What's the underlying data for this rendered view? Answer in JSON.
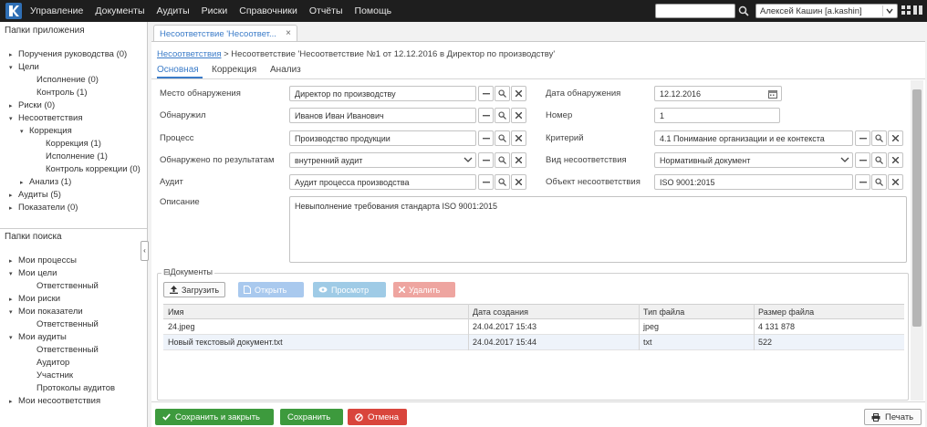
{
  "topbar": {
    "menu": [
      "Управление",
      "Документы",
      "Аудиты",
      "Риски",
      "Справочники",
      "Отчёты",
      "Помощь"
    ],
    "search_value": "",
    "user": "Алексей Кашин [a.kashin]"
  },
  "left_panel": {
    "app_folders_title": "Папки приложения",
    "app_tree": [
      {
        "label": "Поручения руководства (0)",
        "arrow": "▸"
      },
      {
        "label": "Цели",
        "arrow": "▾"
      },
      {
        "label": "Исполнение (0)",
        "arrow": ""
      },
      {
        "label": "Контроль (1)",
        "arrow": ""
      },
      {
        "label": "Риски (0)",
        "arrow": "▸"
      },
      {
        "label": "Несоответствия",
        "arrow": "▾"
      },
      {
        "label": "Коррекция",
        "arrow": "▾"
      },
      {
        "label": "Коррекция (1)",
        "arrow": ""
      },
      {
        "label": "Исполнение (1)",
        "arrow": ""
      },
      {
        "label": "Контроль коррекции (0)",
        "arrow": ""
      },
      {
        "label": "Анализ (1)",
        "arrow": "▸"
      },
      {
        "label": "Аудиты (5)",
        "arrow": "▸"
      },
      {
        "label": "Показатели (0)",
        "arrow": "▸"
      }
    ],
    "search_folders_title": "Папки поиска",
    "search_tree": [
      {
        "label": "Мои процессы",
        "arrow": "▸"
      },
      {
        "label": "Мои цели",
        "arrow": "▾"
      },
      {
        "label": "Ответственный",
        "arrow": ""
      },
      {
        "label": "Мои риски",
        "arrow": "▸"
      },
      {
        "label": "Мои показатели",
        "arrow": "▾"
      },
      {
        "label": "Ответственный",
        "arrow": ""
      },
      {
        "label": "Мои аудиты",
        "arrow": "▾"
      },
      {
        "label": "Ответственный",
        "arrow": ""
      },
      {
        "label": "Аудитор",
        "arrow": ""
      },
      {
        "label": "Участник",
        "arrow": ""
      },
      {
        "label": "Протоколы аудитов",
        "arrow": ""
      },
      {
        "label": "Мои несоответствия",
        "arrow": "▸"
      }
    ],
    "collapse_glyph": "‹"
  },
  "doc_tab": {
    "label": "Несоответствие 'Несоответ...",
    "close": "×"
  },
  "breadcrumb": {
    "link": "Несоответствия",
    "rest": " > Несоответствие 'Несоответствие №1 от 12.12.2016 в Директор по производству'"
  },
  "subtabs": [
    "Основная",
    "Коррекция",
    "Анализ"
  ],
  "form": {
    "place_label": "Место обнаружения",
    "place_value": "Директор по производству",
    "found_by_label": "Обнаружил",
    "found_by_value": "Иванов Иван Иванович",
    "process_label": "Процесс",
    "process_value": "Производство продукции",
    "found_result_label": "Обнаружено по результатам",
    "found_result_value": "внутренний аудит",
    "audit_label": "Аудит",
    "audit_value": "Аудит процесса производства",
    "date_label": "Дата обнаружения",
    "date_value": "12.12.2016",
    "number_label": "Номер",
    "number_value": "1",
    "criterion_label": "Критерий",
    "criterion_value": "4.1  Понимание организации и ее контекста",
    "type_label": "Вид несоответствия",
    "type_value": "Нормативный документ",
    "object_label": "Объект несоответствия",
    "object_value": "ISO 9001:2015",
    "description_label": "Описание",
    "description_value": "Невыполнение требования стандарта ISO 9001:2015"
  },
  "documents": {
    "legend": "⊟Документы",
    "buttons": {
      "upload": "Загрузить",
      "open": "Открыть",
      "view": "Просмотр",
      "delete": "Удалить"
    },
    "columns": [
      "Имя",
      "Дата создания",
      "Тип файла",
      "Размер файла"
    ],
    "rows": [
      [
        "24.jpeg",
        "24.04.2017 15:43",
        "jpeg",
        "4 131 878"
      ],
      [
        "Новый текстовый документ.txt",
        "24.04.2017 15:44",
        "txt",
        "522"
      ]
    ]
  },
  "footer": {
    "save_close": "Сохранить и закрыть",
    "save": "Сохранить",
    "cancel": "Отмена",
    "print": "Печать"
  },
  "colors": {
    "accent": "#3a7bc8",
    "save_green": "#3d9a3d",
    "cancel_red": "#d9453c",
    "topbar": "#1e1e1e"
  }
}
